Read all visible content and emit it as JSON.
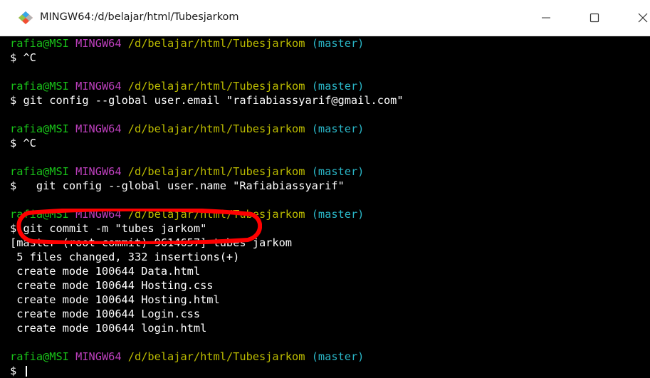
{
  "window": {
    "title": "MINGW64:/d/belajar/html/Tubesjarkom",
    "icon": "git-bash-icon",
    "controls": {
      "minimize_icon": "minimize-icon",
      "maximize_icon": "maximize-icon",
      "close_icon": "close-icon"
    }
  },
  "prompt": {
    "user": "rafia@MSI",
    "host": "MINGW64",
    "path": "/d/belajar/html/Tubesjarkom",
    "branch": "(master)",
    "symbol": "$"
  },
  "terminal": {
    "commands": {
      "c1": "^C",
      "c2": "git config --global user.email \"rafiabiassyarif@gmail.com\"",
      "c3": "^C",
      "c4": "  git config --global user.name \"Rafiabiassyarif\"",
      "c5": "git commit -m \"tubes jarkom\"",
      "c6": ""
    },
    "output": {
      "commit_line": "[master (root-commit) 9614657] tubes jarkom",
      "stat_line": " 5 files changed, 332 insertions(+)",
      "create_lines": [
        " create mode 100644 Data.html",
        " create mode 100644 Hosting.css",
        " create mode 100644 Hosting.html",
        " create mode 100644 Login.css",
        " create mode 100644 login.html"
      ]
    }
  },
  "colors": {
    "background": "#000000",
    "user": "#19c419",
    "host": "#bc3fbc",
    "path": "#bcbc00",
    "branch": "#2ab6c7",
    "text": "#ffffff",
    "annotation": "#ff0000"
  },
  "annotation": {
    "shape": "red-hand-drawn-ellipse",
    "target": "git commit command"
  }
}
